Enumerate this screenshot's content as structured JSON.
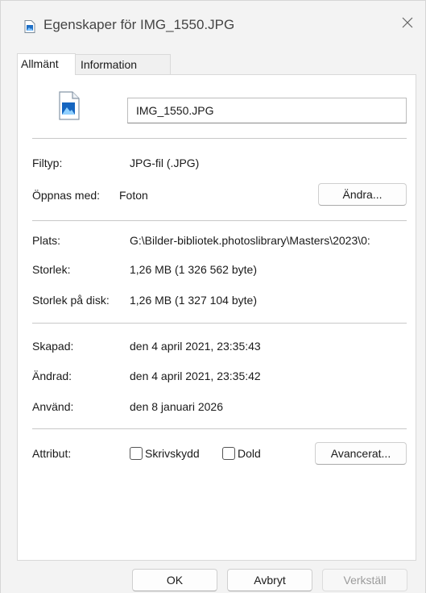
{
  "window": {
    "title": "Egenskaper för IMG_1550.JPG",
    "icon": "image-file-icon",
    "close_icon": "close-icon"
  },
  "tabs": [
    {
      "label": "Allmänt",
      "active": true
    },
    {
      "label": "Information",
      "active": false
    }
  ],
  "general": {
    "file_icon": "photo-file-icon",
    "file_name": "IMG_1550.JPG",
    "type_label": "Filtyp:",
    "type_value": "JPG-fil (.JPG)",
    "opens_with_label": "Öppnas med:",
    "opens_with_value": "Foton",
    "change_button": "Ändra...",
    "location_label": "Plats:",
    "location_value": "G:\\Bilder-bibliotek.photoslibrary\\Masters\\2023\\0:",
    "size_label": "Storlek:",
    "size_value": "1,26 MB (1 326 562 byte)",
    "size_on_disk_label": "Storlek på disk:",
    "size_on_disk_value": "1,26 MB (1 327 104 byte)",
    "created_label": "Skapad:",
    "created_value": "den 4 april 2021, 23:35:43",
    "modified_label": "Ändrad:",
    "modified_value": "den 4 april 2021, 23:35:42",
    "accessed_label": "Använd:",
    "accessed_value": "den 8 januari 2026",
    "attributes_label": "Attribut:",
    "readonly_label": "Skrivskydd",
    "readonly_checked": false,
    "hidden_label": "Dold",
    "hidden_checked": false,
    "advanced_button": "Avancerat..."
  },
  "footer": {
    "ok": "OK",
    "cancel": "Avbryt",
    "apply": "Verkställ"
  },
  "colors": {
    "accent": "#0067c0",
    "window_bg": "#f3f3f3",
    "panel_bg": "#ffffff"
  }
}
